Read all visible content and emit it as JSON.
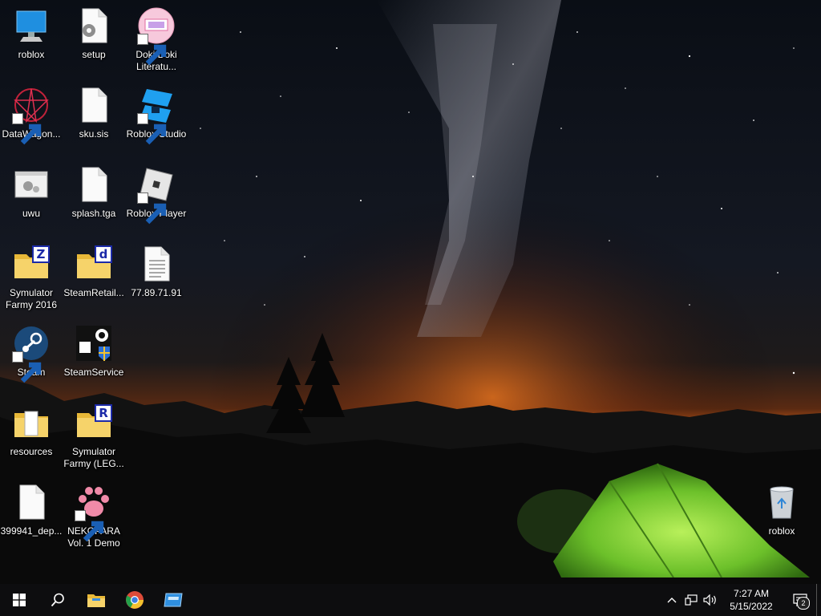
{
  "desktop": {
    "icons": [
      {
        "label": "roblox",
        "icon": "computer-icon"
      },
      {
        "label": "setup",
        "icon": "settings-file-icon"
      },
      {
        "label": "Doki Doki Literatu...",
        "icon": "doki-doki-icon"
      },
      {
        "label": "DataWagon...",
        "icon": "datawagon-icon"
      },
      {
        "label": "sku.sis",
        "icon": "blank-file-icon"
      },
      {
        "label": "Roblox Studio",
        "icon": "roblox-studio-icon"
      },
      {
        "label": "uwu",
        "icon": "window-gear-icon"
      },
      {
        "label": "splash.tga",
        "icon": "blank-file-icon"
      },
      {
        "label": "Roblox Player",
        "icon": "roblox-player-icon"
      },
      {
        "label": "Symulator Farmy 2016",
        "icon": "folder-z-icon"
      },
      {
        "label": "SteamRetail...",
        "icon": "folder-d-icon"
      },
      {
        "label": "77.89.71.91",
        "icon": "text-file-icon"
      },
      {
        "label": "Steam",
        "icon": "steam-icon"
      },
      {
        "label": "SteamService",
        "icon": "steamservice-icon"
      },
      {
        "label": "resources",
        "icon": "folder-icon"
      },
      {
        "label": "Symulator Farmy (LEG...",
        "icon": "folder-r-icon"
      },
      {
        "label": "399941_dep...",
        "icon": "blank-file-icon"
      },
      {
        "label": "NEKOPARA Vol. 1 Demo",
        "icon": "paw-icon"
      },
      {
        "label": "roblox",
        "icon": "recycle-bin-icon"
      }
    ]
  },
  "taskbar": {
    "items": [
      "start-icon",
      "search-icon",
      "file-explorer-icon",
      "chrome-icon",
      "window-app-icon"
    ],
    "tray": [
      "chevron-up-icon",
      "network-icon",
      "volume-icon"
    ],
    "time": "7:27 AM",
    "date": "5/15/2022",
    "notification_count": "2"
  },
  "colors": {
    "taskbar_bg": "#0d0d0f",
    "tent": "#7fd640",
    "horizon_glow": "#d8641a",
    "folder": "#f2c94c"
  }
}
